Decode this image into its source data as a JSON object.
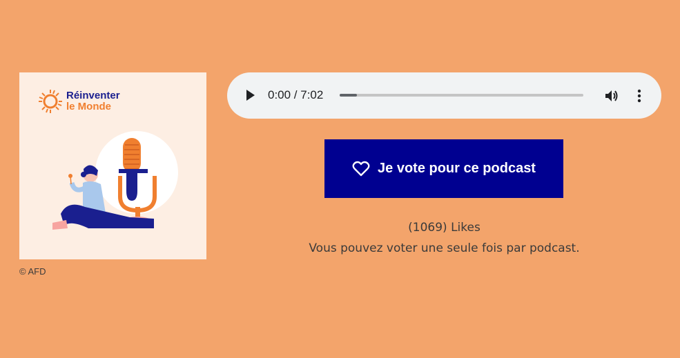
{
  "cover": {
    "brand_line1": "Réinventer",
    "brand_line2": "le Monde",
    "credit": "© AFD",
    "colors": {
      "navy": "#1a1f8f",
      "orange": "#f07f2f",
      "cream": "#fdeee3"
    }
  },
  "player": {
    "time": "0:00 / 7:02",
    "progress_fraction": 0.07,
    "play_icon": "play-icon",
    "volume_icon": "volume-icon",
    "menu_icon": "more-vert-icon"
  },
  "vote": {
    "label": "Je vote pour ce podcast",
    "icon": "heart-icon",
    "color": "#000090"
  },
  "likes": "(1069) Likes",
  "notice": "Vous pouvez voter une seule fois par podcast.",
  "page": {
    "background": "#f3a46b"
  }
}
